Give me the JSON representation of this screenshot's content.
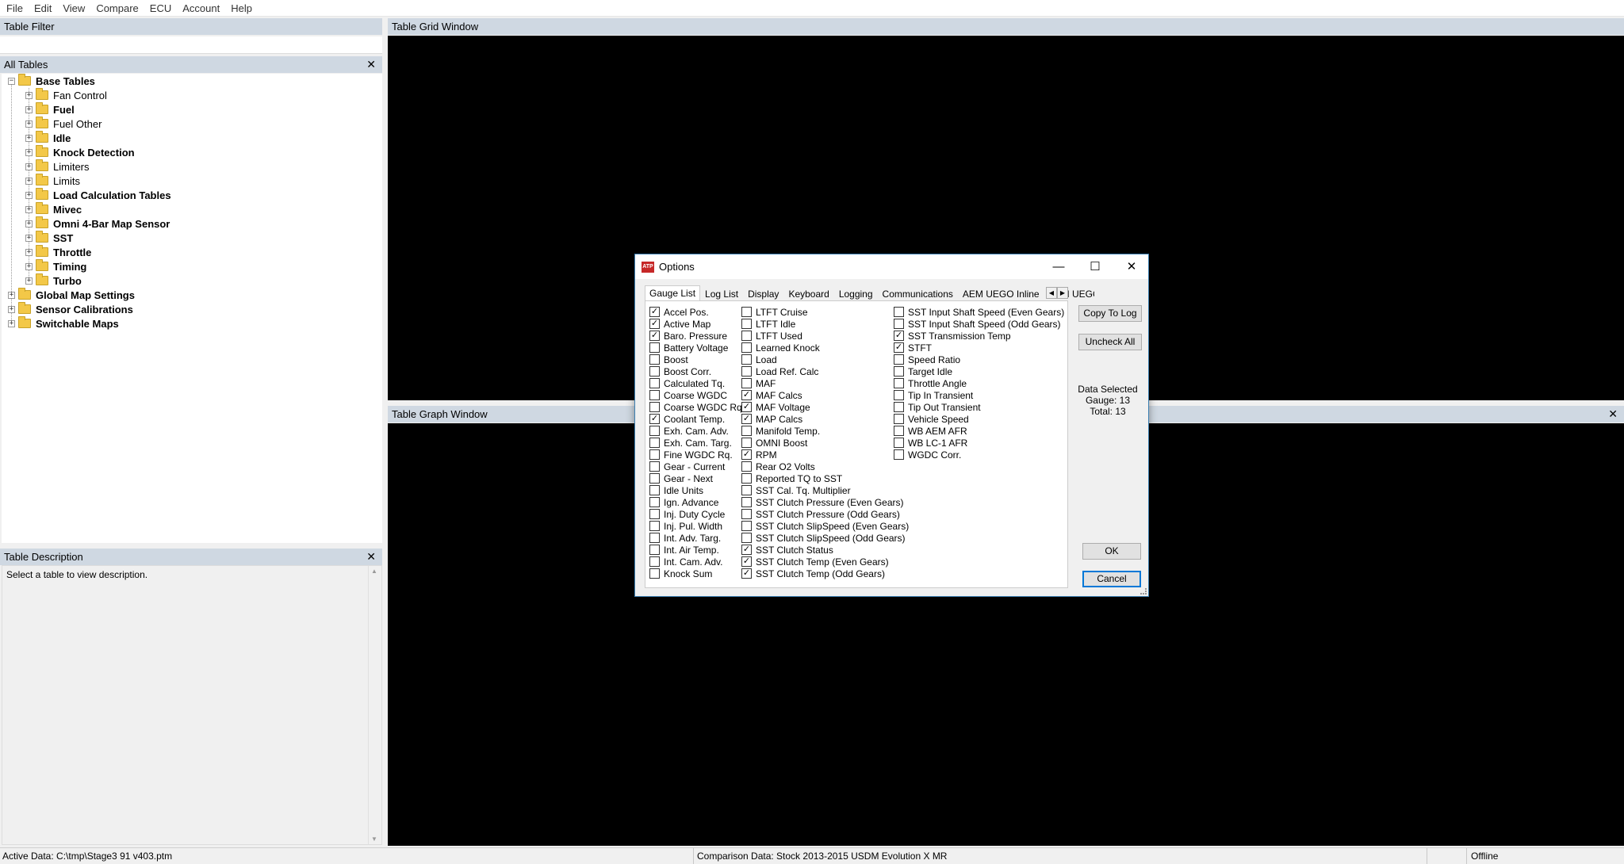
{
  "menubar": [
    "File",
    "Edit",
    "View",
    "Compare",
    "ECU",
    "Account",
    "Help"
  ],
  "table_filter": {
    "title": "Table Filter"
  },
  "all_tables": {
    "title": "All Tables",
    "close": "✕",
    "tree": [
      {
        "label": "Base Tables",
        "bold": true,
        "level": 0,
        "expanded": true
      },
      {
        "label": "Fan Control",
        "bold": false,
        "level": 1
      },
      {
        "label": "Fuel",
        "bold": true,
        "level": 1
      },
      {
        "label": "Fuel Other",
        "bold": false,
        "level": 1
      },
      {
        "label": "Idle",
        "bold": true,
        "level": 1
      },
      {
        "label": "Knock Detection",
        "bold": true,
        "level": 1
      },
      {
        "label": "Limiters",
        "bold": false,
        "level": 1
      },
      {
        "label": "Limits",
        "bold": false,
        "level": 1
      },
      {
        "label": "Load Calculation Tables",
        "bold": true,
        "level": 1
      },
      {
        "label": "Mivec",
        "bold": true,
        "level": 1
      },
      {
        "label": "Omni 4-Bar Map Sensor",
        "bold": true,
        "level": 1
      },
      {
        "label": "SST",
        "bold": true,
        "level": 1
      },
      {
        "label": "Throttle",
        "bold": true,
        "level": 1
      },
      {
        "label": "Timing",
        "bold": true,
        "level": 1
      },
      {
        "label": "Turbo",
        "bold": true,
        "level": 1
      },
      {
        "label": "Global Map Settings",
        "bold": true,
        "level": 0
      },
      {
        "label": "Sensor Calibrations",
        "bold": true,
        "level": 0
      },
      {
        "label": "Switchable Maps",
        "bold": true,
        "level": 0
      }
    ]
  },
  "table_description": {
    "title": "Table Description",
    "close": "✕",
    "text": "Select a table to view description."
  },
  "grid_window": {
    "title": "Table Grid Window"
  },
  "graph_window": {
    "title": "Table Graph Window",
    "close": "✕"
  },
  "statusbar": {
    "active_data": "Active Data: C:\\tmp\\Stage3 91 v403.ptm",
    "comparison_data": "Comparison Data: Stock 2013-2015 USDM Evolution X MR",
    "status": "Offline"
  },
  "dialog": {
    "title": "Options",
    "logo": "ATP",
    "minimize": "—",
    "maximize": "☐",
    "close": "✕",
    "tabs": [
      "Gauge List",
      "Log List",
      "Display",
      "Keyboard",
      "Logging",
      "Communications",
      "AEM UEGO Inline",
      "AEM UEGO"
    ],
    "active_tab": "Gauge List",
    "scroll_left": "◀",
    "scroll_right": "▶",
    "columns": [
      [
        {
          "label": "Accel Pos.",
          "checked": true
        },
        {
          "label": "Active Map",
          "checked": true
        },
        {
          "label": "Baro. Pressure",
          "checked": true
        },
        {
          "label": "Battery Voltage",
          "checked": false
        },
        {
          "label": "Boost",
          "checked": false
        },
        {
          "label": "Boost Corr.",
          "checked": false
        },
        {
          "label": "Calculated Tq.",
          "checked": false
        },
        {
          "label": "Coarse WGDC",
          "checked": false
        },
        {
          "label": "Coarse WGDC Rq.",
          "checked": false
        },
        {
          "label": "Coolant Temp.",
          "checked": true
        },
        {
          "label": "Exh. Cam. Adv.",
          "checked": false
        },
        {
          "label": "Exh. Cam. Targ.",
          "checked": false
        },
        {
          "label": "Fine WGDC Rq.",
          "checked": false
        },
        {
          "label": "Gear - Current",
          "checked": false
        },
        {
          "label": "Gear - Next",
          "checked": false
        },
        {
          "label": "Idle Units",
          "checked": false
        },
        {
          "label": "Ign. Advance",
          "checked": false
        },
        {
          "label": "Inj. Duty Cycle",
          "checked": false
        },
        {
          "label": "Inj. Pul. Width",
          "checked": false
        },
        {
          "label": "Int. Adv. Targ.",
          "checked": false
        },
        {
          "label": "Int. Air Temp.",
          "checked": false
        },
        {
          "label": "Int. Cam. Adv.",
          "checked": false
        },
        {
          "label": "Knock Sum",
          "checked": false
        }
      ],
      [
        {
          "label": "LTFT Cruise",
          "checked": false
        },
        {
          "label": "LTFT Idle",
          "checked": false
        },
        {
          "label": "LTFT Used",
          "checked": false
        },
        {
          "label": "Learned Knock",
          "checked": false
        },
        {
          "label": "Load",
          "checked": false
        },
        {
          "label": "Load Ref. Calc",
          "checked": false
        },
        {
          "label": "MAF",
          "checked": false
        },
        {
          "label": "MAF Calcs",
          "checked": true
        },
        {
          "label": "MAF Voltage",
          "checked": true
        },
        {
          "label": "MAP Calcs",
          "checked": true
        },
        {
          "label": "Manifold Temp.",
          "checked": false
        },
        {
          "label": "OMNI Boost",
          "checked": false
        },
        {
          "label": "RPM",
          "checked": true
        },
        {
          "label": "Rear O2 Volts",
          "checked": false
        },
        {
          "label": "Reported TQ to SST",
          "checked": false
        },
        {
          "label": "SST Cal. Tq. Multiplier",
          "checked": false
        },
        {
          "label": "SST Clutch Pressure (Even Gears)",
          "checked": false
        },
        {
          "label": "SST Clutch Pressure (Odd Gears)",
          "checked": false
        },
        {
          "label": "SST Clutch SlipSpeed (Even Gears)",
          "checked": false
        },
        {
          "label": "SST Clutch SlipSpeed (Odd Gears)",
          "checked": false
        },
        {
          "label": "SST Clutch Status",
          "checked": true
        },
        {
          "label": "SST Clutch Temp (Even Gears)",
          "checked": true
        },
        {
          "label": "SST Clutch Temp (Odd Gears)",
          "checked": true
        }
      ],
      [
        {
          "label": "SST Input Shaft Speed (Even Gears)",
          "checked": false
        },
        {
          "label": "SST Input Shaft Speed (Odd Gears)",
          "checked": false
        },
        {
          "label": "SST Transmission Temp",
          "checked": true
        },
        {
          "label": "STFT",
          "checked": true
        },
        {
          "label": "Speed Ratio",
          "checked": false
        },
        {
          "label": "Target Idle",
          "checked": false
        },
        {
          "label": "Throttle Angle",
          "checked": false
        },
        {
          "label": "Tip In Transient",
          "checked": false
        },
        {
          "label": "Tip Out Transient",
          "checked": false
        },
        {
          "label": "Vehicle Speed",
          "checked": false
        },
        {
          "label": "WB AEM AFR",
          "checked": false
        },
        {
          "label": "WB LC-1 AFR",
          "checked": false
        },
        {
          "label": "WGDC Corr.",
          "checked": false
        }
      ]
    ],
    "copy_to_log": "Copy To Log",
    "uncheck_all": "Uncheck All",
    "data_selected": {
      "title": "Data Selected",
      "gauge": "Gauge: 13",
      "total": "Total: 13"
    },
    "ok": "OK",
    "cancel": "Cancel"
  }
}
